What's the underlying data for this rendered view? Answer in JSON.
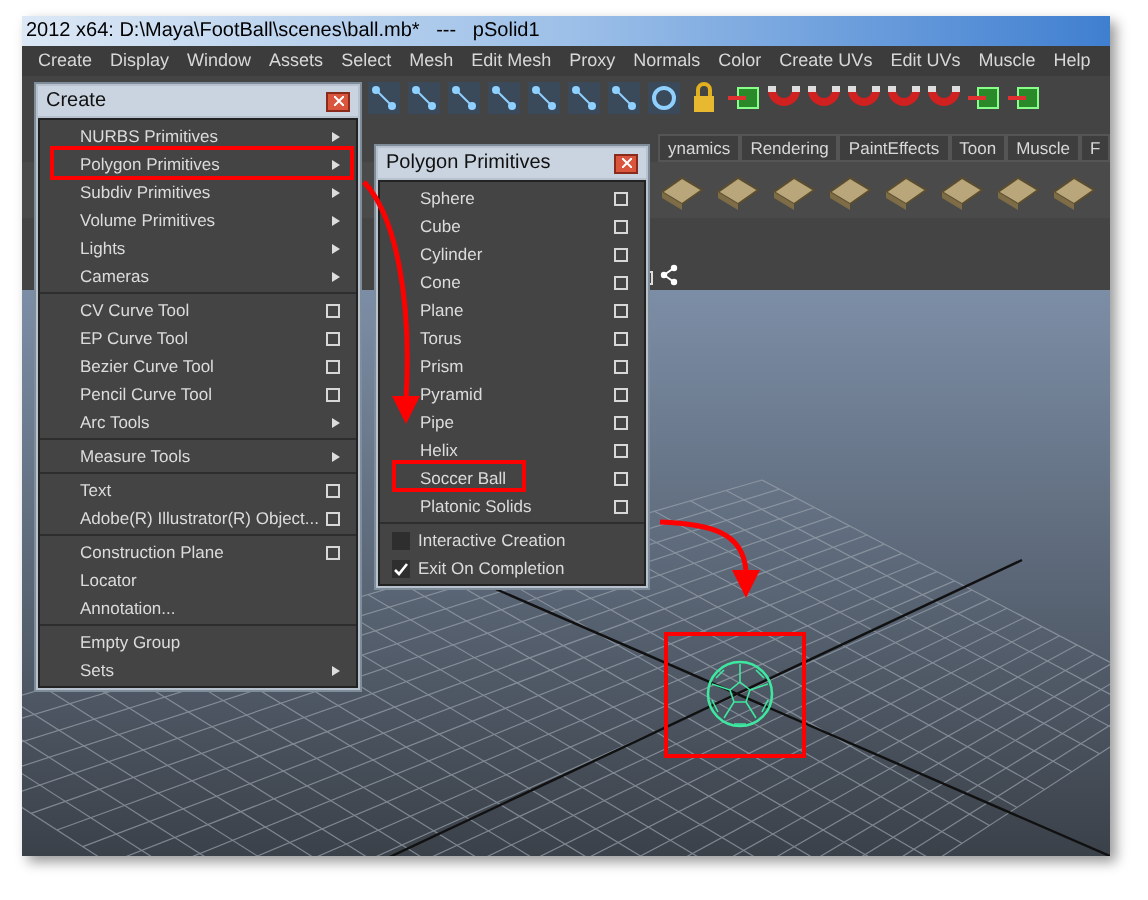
{
  "window": {
    "title": "2012 x64: D:\\Maya\\FootBall\\scenes\\ball.mb*   ---   pSolid1"
  },
  "menu_bar": [
    "Create",
    "Display",
    "Window",
    "Assets",
    "Select",
    "Mesh",
    "Edit Mesh",
    "Proxy",
    "Normals",
    "Color",
    "Create UVs",
    "Edit UVs",
    "Muscle",
    "Help"
  ],
  "shelf_tabs": [
    "ynamics",
    "Rendering",
    "PaintEffects",
    "Toon",
    "Muscle",
    "F"
  ],
  "create_menu": {
    "title": "Create",
    "sections": [
      [
        {
          "label": "NURBS Primitives",
          "kind": "submenu"
        },
        {
          "label": "Polygon Primitives",
          "kind": "submenu"
        },
        {
          "label": "Subdiv Primitives",
          "kind": "submenu"
        },
        {
          "label": "Volume Primitives",
          "kind": "submenu"
        },
        {
          "label": "Lights",
          "kind": "submenu"
        },
        {
          "label": "Cameras",
          "kind": "submenu"
        }
      ],
      [
        {
          "label": "CV Curve Tool",
          "kind": "option"
        },
        {
          "label": "EP Curve Tool",
          "kind": "option"
        },
        {
          "label": "Bezier Curve Tool",
          "kind": "option"
        },
        {
          "label": "Pencil Curve Tool",
          "kind": "option"
        },
        {
          "label": "Arc Tools",
          "kind": "submenu"
        }
      ],
      [
        {
          "label": "Measure Tools",
          "kind": "submenu"
        }
      ],
      [
        {
          "label": "Text",
          "kind": "option"
        },
        {
          "label": "Adobe(R) Illustrator(R) Object...",
          "kind": "option"
        }
      ],
      [
        {
          "label": "Construction Plane",
          "kind": "option"
        },
        {
          "label": "Locator",
          "kind": "plain"
        },
        {
          "label": "Annotation...",
          "kind": "plain"
        }
      ],
      [
        {
          "label": "Empty Group",
          "kind": "plain"
        },
        {
          "label": "Sets",
          "kind": "submenu"
        }
      ]
    ]
  },
  "polygon_menu": {
    "title": "Polygon Primitives",
    "items": [
      {
        "label": "Sphere",
        "kind": "option"
      },
      {
        "label": "Cube",
        "kind": "option"
      },
      {
        "label": "Cylinder",
        "kind": "option"
      },
      {
        "label": "Cone",
        "kind": "option"
      },
      {
        "label": "Plane",
        "kind": "option"
      },
      {
        "label": "Torus",
        "kind": "option"
      },
      {
        "label": "Prism",
        "kind": "option"
      },
      {
        "label": "Pyramid",
        "kind": "option"
      },
      {
        "label": "Pipe",
        "kind": "option"
      },
      {
        "label": "Helix",
        "kind": "option"
      },
      {
        "label": "Soccer Ball",
        "kind": "option"
      },
      {
        "label": "Platonic Solids",
        "kind": "option"
      }
    ],
    "toggles": [
      {
        "label": "Interactive Creation",
        "checked": false
      },
      {
        "label": "Exit On Completion",
        "checked": true
      }
    ]
  }
}
